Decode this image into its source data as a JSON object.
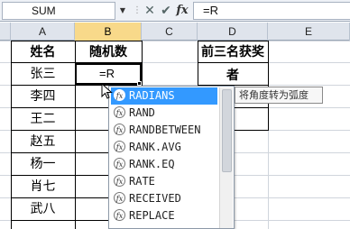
{
  "formula_bar": {
    "name_box": "SUM",
    "cancel_icon": "close-icon",
    "enter_icon": "check-icon",
    "fx_label": "fx",
    "formula": "=R"
  },
  "columns": [
    "A",
    "B",
    "C",
    "D",
    "E"
  ],
  "active_column": "B",
  "table": {
    "headers": [
      "姓名",
      "随机数"
    ],
    "names": [
      "张三",
      "李四",
      "王二",
      "赵五",
      "杨一",
      "肖七",
      "武八"
    ]
  },
  "winners_header": "前三名获奖者",
  "active_cell_text": "=R",
  "autocomplete": {
    "items": [
      "RADIANS",
      "RAND",
      "RANDBETWEEN",
      "RANK.AVG",
      "RANK.EQ",
      "RATE",
      "RECEIVED",
      "REPLACE"
    ],
    "selected_index": 0,
    "icon": "fx-function-icon"
  },
  "tooltip": "将角度转为弧度",
  "colors": {
    "selection": "#3399ff",
    "active_column_header": "#f8d98a"
  }
}
